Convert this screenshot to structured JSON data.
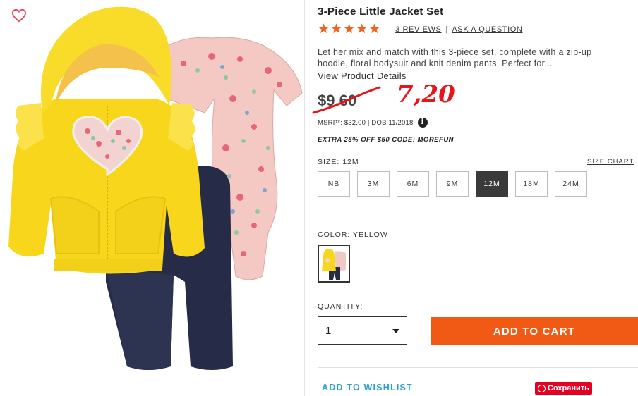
{
  "product": {
    "title": "3-Piece Little Jacket Set",
    "stars": "★★★★★",
    "reviews_link": "3 REVIEWS",
    "separator": "|",
    "ask_link": "ASK A QUESTION",
    "description": "Let her mix and match with this 3-piece set, complete with a zip-up hoodie, floral bodysuit and knit denim pants. Perfect for...",
    "view_details": "View Product Details"
  },
  "pricing": {
    "old_price": "$9.60",
    "handwritten_price": "7,20",
    "msrp_line": "MSRP*: $32.00 | DOB 11/2018",
    "info_icon": "i",
    "promo": "EXTRA 25% OFF $50 CODE: MOREFUN"
  },
  "size": {
    "label": "SIZE:",
    "selected": "12M",
    "chart_link": "SIZE CHART",
    "options": [
      "NB",
      "3M",
      "6M",
      "9M",
      "12M",
      "18M",
      "24M"
    ]
  },
  "color": {
    "label": "COLOR: YELLOW"
  },
  "quantity": {
    "label": "QUANTITY:",
    "value": "1"
  },
  "actions": {
    "add_to_cart": "ADD TO CART",
    "add_to_wishlist": "ADD TO WISHLIST",
    "pin_save": "Сохранить"
  },
  "colors": {
    "accent_orange": "#f15a14",
    "star_orange": "#f2611a",
    "price_red": "#e8141c",
    "wishlist_blue": "#2a9fd6",
    "pinterest_red": "#e60023",
    "heart_outline": "#e8435a"
  }
}
